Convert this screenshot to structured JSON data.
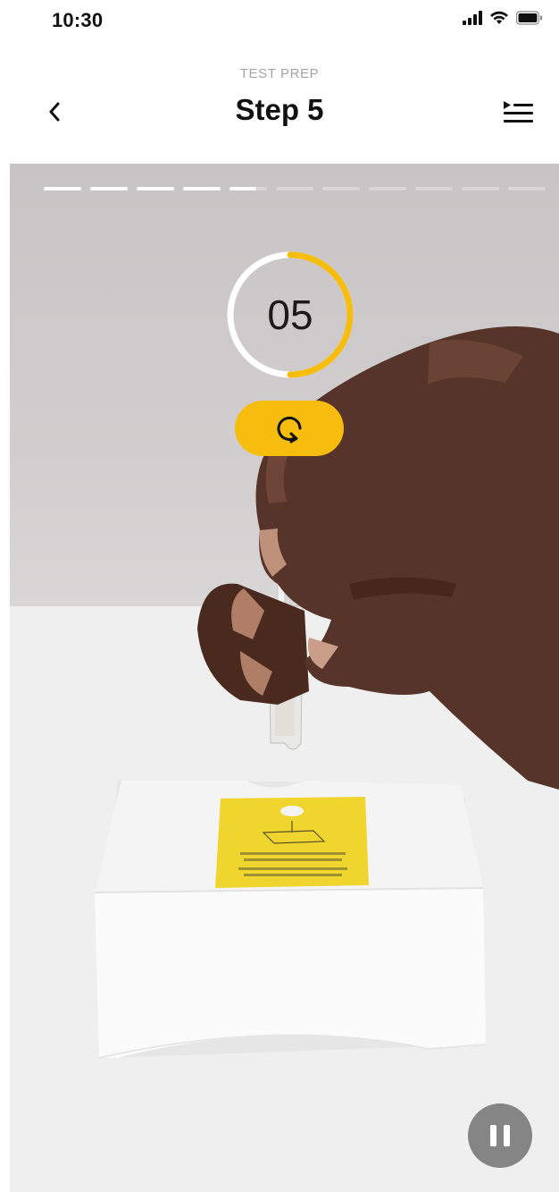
{
  "status_bar": {
    "time": "10:30"
  },
  "header": {
    "eyebrow": "TEST PREP",
    "title": "Step 5"
  },
  "progress": {
    "total_steps": 11,
    "completed_steps": 4,
    "current_step": 5,
    "current_step_fraction": 0.7
  },
  "timer": {
    "value": "05",
    "remaining_fraction": 0.5
  },
  "colors": {
    "accent": "#f6bd0f",
    "timer_track": "#ffffff",
    "progress_done": "#ffffff"
  },
  "icons": {
    "back": "chevron-left-icon",
    "menu": "step-list-icon",
    "replay": "replay-icon",
    "pause": "pause-icon"
  }
}
